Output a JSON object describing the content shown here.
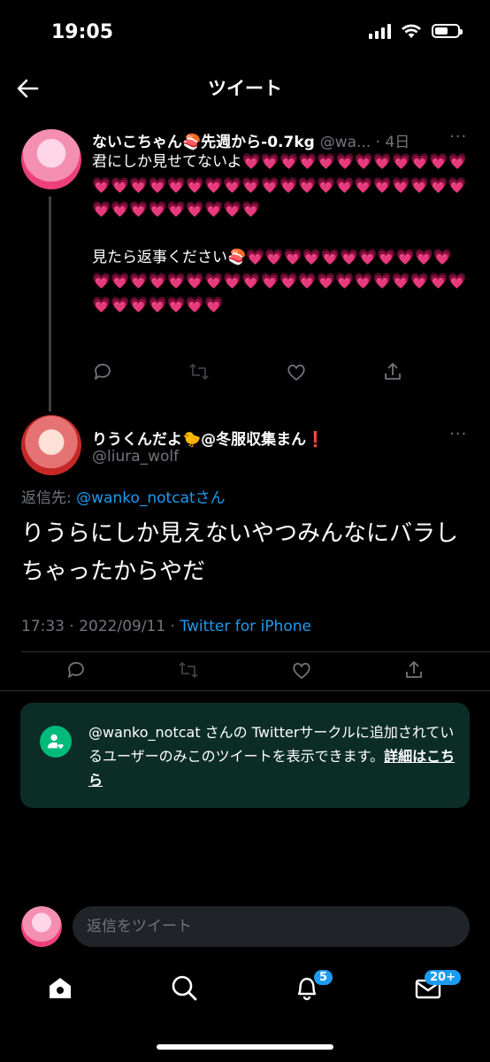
{
  "status_bar": {
    "time": "19:05"
  },
  "nav": {
    "title": "ツイート"
  },
  "parent_tweet": {
    "display_name": "ないこちゃん🍣先週から-0.7kg",
    "handle_time": "@wa... · 4日",
    "body": "君にしか見せてないよ💗💗💗💗💗💗💗💗💗💗💗💗💗💗💗💗💗💗💗💗💗💗💗💗💗💗💗💗💗💗💗💗💗💗💗💗💗💗💗💗💗\n\n見たら返事ください🍣💗💗💗💗💗💗💗💗💗💗💗💗💗💗💗💗💗💗💗💗💗💗💗💗💗💗💗💗💗💗💗💗💗💗💗💗💗💗"
  },
  "main_tweet": {
    "display_name": "りうくんだよ🐤@冬服収集まん❗️",
    "handle": "@liura_wolf",
    "reply_to_prefix": "返信先: ",
    "reply_to_handle": "@wanko_notcat",
    "reply_to_suffix": "さん",
    "body": "りうらにしか見えないやつみんなにバラしちゃったからやだ",
    "timestamp": "17:33 · 2022/09/11 · ",
    "source": "Twitter for iPhone"
  },
  "circle_notice": {
    "text": "@wanko_notcat さんの Twitterサークルに追加されているユーザーのみこのツイートを表示できます。",
    "link": "詳細はこちら"
  },
  "reply_bar": {
    "placeholder": "返信をツイート"
  },
  "tab_bar": {
    "notifications_badge": "5",
    "messages_badge": "20+"
  },
  "colors": {
    "accent": "#1d9bf0",
    "circle_green": "#00ba7c",
    "circle_bg": "#0c2d26"
  }
}
